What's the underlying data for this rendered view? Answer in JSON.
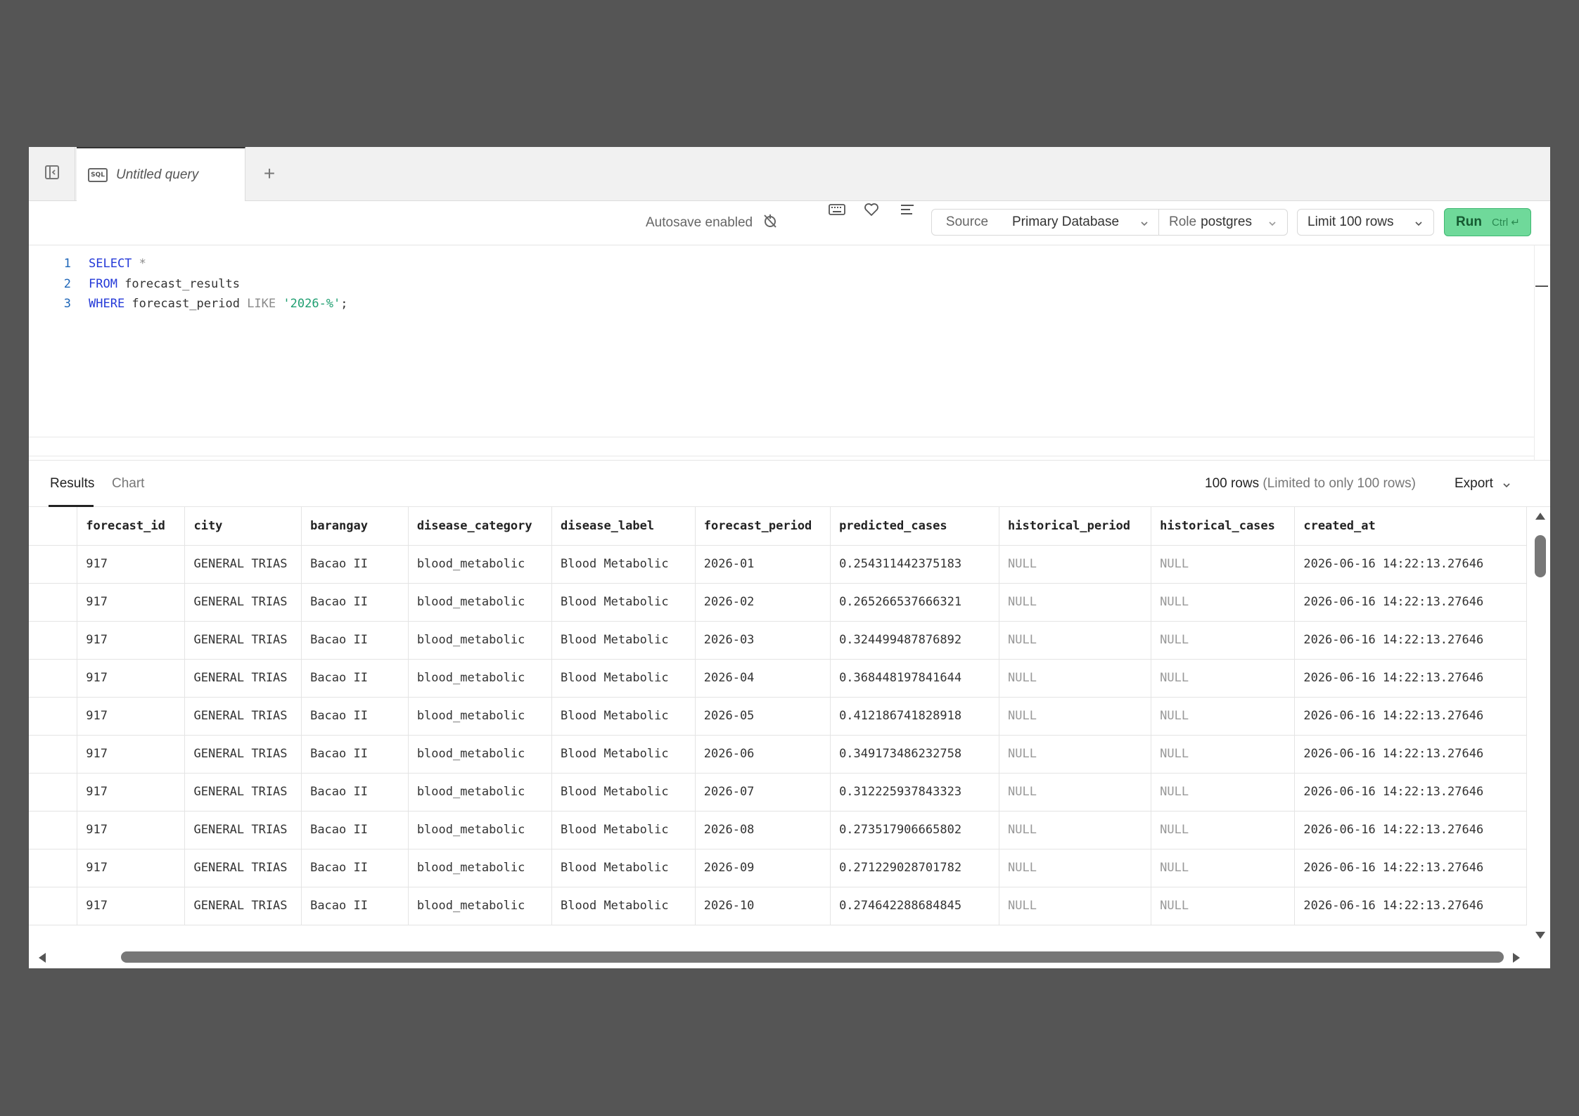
{
  "tabs": [
    {
      "label": "Untitled query",
      "badge": "SQL"
    }
  ],
  "new_tab_label": "+",
  "toolbar": {
    "autosave": "Autosave enabled",
    "source_label": "Source",
    "database": "Primary Database",
    "role_prefix": "Role",
    "role_value": "postgres",
    "limit": "Limit 100 rows",
    "run_label": "Run",
    "run_shortcut": "Ctrl ↵"
  },
  "editor": {
    "line_numbers": [
      "1",
      "2",
      "3"
    ],
    "lines": [
      [
        {
          "t": "SELECT",
          "c": "kw"
        },
        {
          "t": " *",
          "c": "op"
        }
      ],
      [
        {
          "t": "FROM",
          "c": "kw"
        },
        {
          "t": " forecast_results",
          "c": ""
        }
      ],
      [
        {
          "t": "WHERE",
          "c": "kw"
        },
        {
          "t": " forecast_period ",
          "c": ""
        },
        {
          "t": "LIKE",
          "c": "op"
        },
        {
          "t": " ",
          "c": ""
        },
        {
          "t": "'2026-%'",
          "c": "str"
        },
        {
          "t": ";",
          "c": ""
        }
      ]
    ]
  },
  "results": {
    "tabs": [
      "Results",
      "Chart"
    ],
    "row_count": "100 rows",
    "row_note": "(Limited to only 100 rows)",
    "export_label": "Export",
    "columns": [
      "forecast_id",
      "city",
      "barangay",
      "disease_category",
      "disease_label",
      "forecast_period",
      "predicted_cases",
      "historical_period",
      "historical_cases",
      "created_at"
    ],
    "rows": [
      [
        "917",
        "GENERAL TRIAS",
        "Bacao II",
        "blood_metabolic",
        "Blood Metabolic",
        "2026-01",
        "0.254311442375183",
        "NULL",
        "NULL",
        "2026-06-16 14:22:13.27646"
      ],
      [
        "917",
        "GENERAL TRIAS",
        "Bacao II",
        "blood_metabolic",
        "Blood Metabolic",
        "2026-02",
        "0.265266537666321",
        "NULL",
        "NULL",
        "2026-06-16 14:22:13.27646"
      ],
      [
        "917",
        "GENERAL TRIAS",
        "Bacao II",
        "blood_metabolic",
        "Blood Metabolic",
        "2026-03",
        "0.324499487876892",
        "NULL",
        "NULL",
        "2026-06-16 14:22:13.27646"
      ],
      [
        "917",
        "GENERAL TRIAS",
        "Bacao II",
        "blood_metabolic",
        "Blood Metabolic",
        "2026-04",
        "0.368448197841644",
        "NULL",
        "NULL",
        "2026-06-16 14:22:13.27646"
      ],
      [
        "917",
        "GENERAL TRIAS",
        "Bacao II",
        "blood_metabolic",
        "Blood Metabolic",
        "2026-05",
        "0.412186741828918",
        "NULL",
        "NULL",
        "2026-06-16 14:22:13.27646"
      ],
      [
        "917",
        "GENERAL TRIAS",
        "Bacao II",
        "blood_metabolic",
        "Blood Metabolic",
        "2026-06",
        "0.349173486232758",
        "NULL",
        "NULL",
        "2026-06-16 14:22:13.27646"
      ],
      [
        "917",
        "GENERAL TRIAS",
        "Bacao II",
        "blood_metabolic",
        "Blood Metabolic",
        "2026-07",
        "0.312225937843323",
        "NULL",
        "NULL",
        "2026-06-16 14:22:13.27646"
      ],
      [
        "917",
        "GENERAL TRIAS",
        "Bacao II",
        "blood_metabolic",
        "Blood Metabolic",
        "2026-08",
        "0.273517906665802",
        "NULL",
        "NULL",
        "2026-06-16 14:22:13.27646"
      ],
      [
        "917",
        "GENERAL TRIAS",
        "Bacao II",
        "blood_metabolic",
        "Blood Metabolic",
        "2026-09",
        "0.271229028701782",
        "NULL",
        "NULL",
        "2026-06-16 14:22:13.27646"
      ],
      [
        "917",
        "GENERAL TRIAS",
        "Bacao II",
        "blood_metabolic",
        "Blood Metabolic",
        "2026-10",
        "0.274642288684845",
        "NULL",
        "NULL",
        "2026-06-16 14:22:13.27646"
      ]
    ]
  },
  "icons": {
    "sidebar_toggle": "sidebar-toggle-icon",
    "autosave": "autosave-off-icon",
    "keyboard": "keyboard-icon",
    "favorite": "heart-icon",
    "format": "format-lines-icon",
    "chevron": "chevron-down-icon"
  },
  "colors": {
    "run_button": "#6fd99a",
    "keyword": "#2439d8",
    "string": "#1e9e70",
    "backdrop": "#555555"
  }
}
